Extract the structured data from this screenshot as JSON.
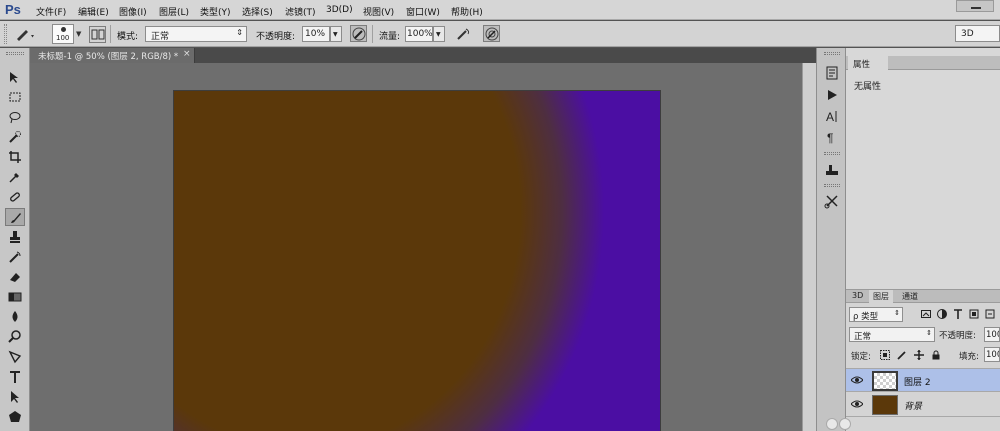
{
  "app": {
    "logo": "Ps",
    "menu": [
      "文件(F)",
      "编辑(E)",
      "图像(I)",
      "图层(L)",
      "类型(Y)",
      "选择(S)",
      "滤镜(T)",
      "3D(D)",
      "视图(V)",
      "窗口(W)",
      "帮助(H)"
    ]
  },
  "options_bar": {
    "brush_size": "100",
    "mode_label": "模式:",
    "mode_value": "正常",
    "opacity_label": "不透明度:",
    "opacity_value": "10%",
    "flow_label": "流量:",
    "flow_value": "100%",
    "workspace": "3D"
  },
  "document": {
    "tab_title": "未标题-1 @ 50% (图层 2, RGB/8) *",
    "tab_close": "×",
    "colors": {
      "fg_brown": "#5b380a",
      "bg_purple": "#4b0ea3"
    }
  },
  "toolbox": {
    "tools": [
      "move-icon",
      "marquee-icon",
      "lasso-icon",
      "quick-select-icon",
      "crop-icon",
      "eyedropper-icon",
      "healing-brush-icon",
      "brush-icon",
      "clone-stamp-icon",
      "history-brush-icon",
      "eraser-icon",
      "gradient-icon",
      "blur-icon",
      "dodge-icon",
      "pen-icon",
      "type-icon",
      "path-select-icon",
      "shape-icon"
    ],
    "active": "brush-icon"
  },
  "properties_panel": {
    "tab": "属性",
    "body": "无属性"
  },
  "layers_panel": {
    "tabs": [
      "3D",
      "图层",
      "通道"
    ],
    "active_tab": "图层",
    "filter_label": "ρ 类型",
    "blend_mode": "正常",
    "opacity_label": "不透明度:",
    "opacity_value": "100",
    "lock_label": "锁定:",
    "fill_label": "填充:",
    "fill_value": "100",
    "layers": [
      {
        "name": "图层 2",
        "selected": true
      },
      {
        "name": "背景",
        "selected": false
      }
    ]
  }
}
